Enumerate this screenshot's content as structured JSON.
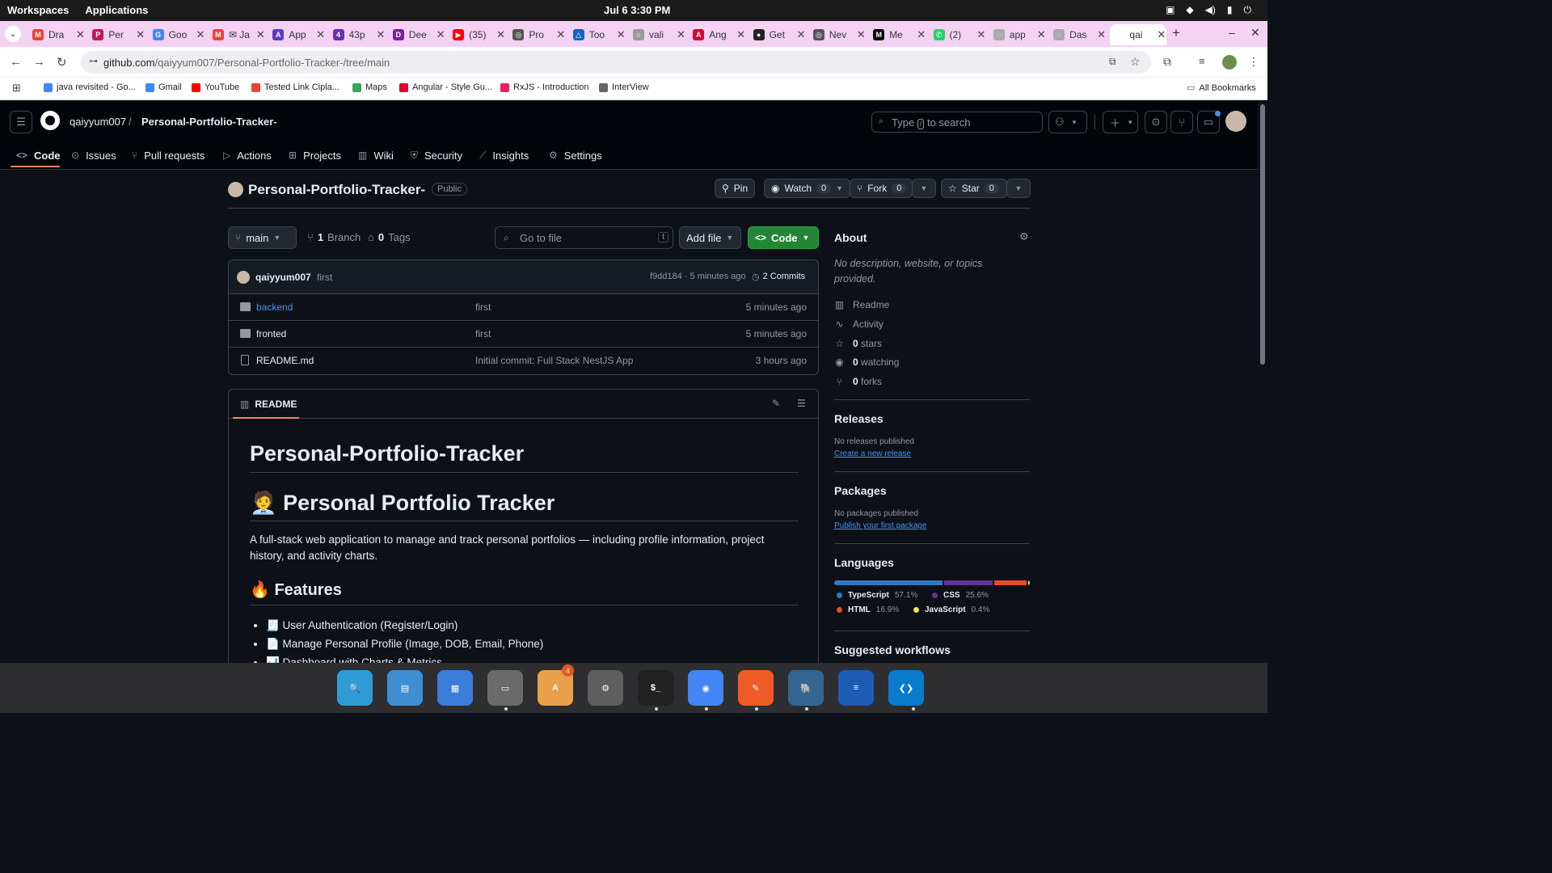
{
  "system_bar": {
    "workspaces": "Workspaces",
    "applications": "Applications",
    "clock": "Jul 6  3:30 PM"
  },
  "tabs": [
    {
      "title": "Dra",
      "icon": "gmail-icon",
      "color": "#ea4335",
      "glyph": "M"
    },
    {
      "title": "Per",
      "icon": "doc-icon",
      "color": "#c2185b",
      "glyph": "P"
    },
    {
      "title": "Goo",
      "icon": "google-icon",
      "color": "#4285f4",
      "glyph": "G"
    },
    {
      "title": "✉ Ja",
      "icon": "gmail-icon",
      "color": "#ea4335",
      "glyph": "M"
    },
    {
      "title": "App",
      "icon": "app-icon",
      "color": "#5b3cc4",
      "glyph": "A"
    },
    {
      "title": "43p",
      "icon": "app-icon",
      "color": "#6b2fb3",
      "glyph": "4"
    },
    {
      "title": "Dee",
      "icon": "app-icon",
      "color": "#7b1fa2",
      "glyph": "D"
    },
    {
      "title": "(35)",
      "icon": "youtube-icon",
      "color": "#ff0000",
      "glyph": "▶"
    },
    {
      "title": "Pro",
      "icon": "chatgpt-icon",
      "color": "#555",
      "glyph": "◎"
    },
    {
      "title": "Too",
      "icon": "app-icon",
      "color": "#1565c0",
      "glyph": "△"
    },
    {
      "title": "vali",
      "icon": "loading-icon",
      "color": "#999",
      "glyph": "○"
    },
    {
      "title": "Ang",
      "icon": "angular-icon",
      "color": "#dd0031",
      "glyph": "A"
    },
    {
      "title": "Get",
      "icon": "github-icon",
      "color": "#222",
      "glyph": "●"
    },
    {
      "title": "Nev",
      "icon": "chatgpt-icon",
      "color": "#555",
      "glyph": "◎"
    },
    {
      "title": "Me",
      "icon": "medium-icon",
      "color": "#000",
      "glyph": "M"
    },
    {
      "title": "(2)",
      "icon": "whatsapp-icon",
      "color": "#25d366",
      "glyph": "✆"
    },
    {
      "title": "app",
      "icon": "globe-icon",
      "color": "#aaa",
      "glyph": "◌"
    },
    {
      "title": "Das",
      "icon": "globe-icon",
      "color": "#aaa",
      "glyph": "◌"
    },
    {
      "title": "qai",
      "icon": "github-icon",
      "color": "#fff",
      "glyph": ""
    }
  ],
  "address": {
    "host": "github.com",
    "path": "/qaiyyum007/Personal-Portfolio-Tracker-/tree/main"
  },
  "bookmarks": [
    {
      "label": "java revisited - Go...",
      "color": "#4285f4"
    },
    {
      "label": "Gmail",
      "color": "#4285f4"
    },
    {
      "label": "YouTube",
      "color": "#ff0000"
    },
    {
      "label": "Tested Link Cipla...",
      "color": "#ea4335"
    },
    {
      "label": "Maps",
      "color": "#34a853"
    },
    {
      "label": "Angular - Style Gu...",
      "color": "#dd0031"
    },
    {
      "label": "RxJS - Introduction",
      "color": "#e91e63"
    },
    {
      "label": "InterView",
      "color": "#666"
    }
  ],
  "all_bookmarks": "All Bookmarks",
  "gh": {
    "owner": "qaiyyum007",
    "repo": "Personal-Portfolio-Tracker-",
    "search_pre": "Type",
    "search_key": "/",
    "search_post": "to search",
    "repo_tabs": [
      "Code",
      "Issues",
      "Pull requests",
      "Actions",
      "Projects",
      "Wiki",
      "Security",
      "Insights",
      "Settings"
    ],
    "repo_name": "Personal-Portfolio-Tracker-",
    "visibility": "Public",
    "pin": "Pin",
    "watch": "Watch",
    "watch_count": "0",
    "fork": "Fork",
    "fork_count": "0",
    "star": "Star",
    "star_count": "0",
    "branch_name": "main",
    "branches_count": "1",
    "branches_label": "Branch",
    "tags_count": "0",
    "tags_label": "Tags",
    "goto_file": "Go to file",
    "goto_key": "t",
    "add_file": "Add file",
    "code_btn": "Code",
    "commit": {
      "author": "qaiyyum007",
      "message": "first",
      "hash_time": "f9dd184 · 5 minutes ago",
      "commits": "2 Commits"
    },
    "files": [
      {
        "name": "backend",
        "type": "dir",
        "message": "first",
        "time": "5 minutes ago"
      },
      {
        "name": "fronted",
        "type": "dir",
        "message": "first",
        "time": "5 minutes ago"
      },
      {
        "name": "README.md",
        "type": "file",
        "message": "Initial commit: Full Stack NestJS App",
        "time": "3 hours ago"
      }
    ],
    "readme": {
      "tab": "README",
      "h1": "Personal-Portfolio-Tracker",
      "h1b": "🧑‍💼 Personal Portfolio Tracker",
      "intro": "A full-stack web application to manage and track personal portfolios — including profile information, project history, and activity charts.",
      "features_title": "🔥 Features",
      "features": [
        "🧾 User Authentication (Register/Login)",
        "📄 Manage Personal Profile (Image, DOB, Email, Phone)",
        "📊 Dashboard with Charts & Metrics"
      ]
    },
    "about": {
      "title": "About",
      "desc": "No description, website, or topics provided.",
      "readme": "Readme",
      "activity": "Activity",
      "stars_count": "0",
      "stars": "stars",
      "watching_count": "0",
      "watching": "watching",
      "forks_count": "0",
      "forks": "forks"
    },
    "releases": {
      "title": "Releases",
      "text": "No releases published",
      "link": "Create a new release"
    },
    "packages": {
      "title": "Packages",
      "text": "No packages published",
      "link": "Publish your first package"
    },
    "languages": {
      "title": "Languages",
      "items": [
        {
          "name": "TypeScript",
          "pct": "57.1%",
          "value": 57.1,
          "color": "#3178c6"
        },
        {
          "name": "CSS",
          "pct": "25.6%",
          "value": 25.6,
          "color": "#663399"
        },
        {
          "name": "HTML",
          "pct": "16.9%",
          "value": 16.9,
          "color": "#e34c26"
        },
        {
          "name": "JavaScript",
          "pct": "0.4%",
          "value": 0.4,
          "color": "#f1e05a"
        }
      ]
    },
    "suggested": "Suggested workflows"
  },
  "dock": [
    {
      "name": "search-app-icon",
      "color": "#2e9bd6",
      "glyph": "🔍"
    },
    {
      "name": "files-window-icon",
      "color": "#3d8fd1",
      "glyph": "▤"
    },
    {
      "name": "app-grid-icon",
      "color": "#3b7dd8",
      "glyph": "▦"
    },
    {
      "name": "file-manager-icon",
      "color": "#6a6a6a",
      "glyph": "▭"
    },
    {
      "name": "software-center-icon",
      "color": "#e9a04a",
      "glyph": "A",
      "badge": "4"
    },
    {
      "name": "settings-icon",
      "color": "#5f5f5f",
      "glyph": "⚙"
    },
    {
      "name": "terminal-icon",
      "color": "#222",
      "glyph": "$_"
    },
    {
      "name": "chrome-icon",
      "color": "#4285f4",
      "glyph": "◉"
    },
    {
      "name": "postman-icon",
      "color": "#ef5b25",
      "glyph": "✎"
    },
    {
      "name": "postgres-icon",
      "color": "#336791",
      "glyph": "🐘"
    },
    {
      "name": "text-editor-icon",
      "color": "#1e5bb5",
      "glyph": "≡"
    },
    {
      "name": "vscode-icon",
      "color": "#0a7acc",
      "glyph": "❮❯"
    }
  ]
}
